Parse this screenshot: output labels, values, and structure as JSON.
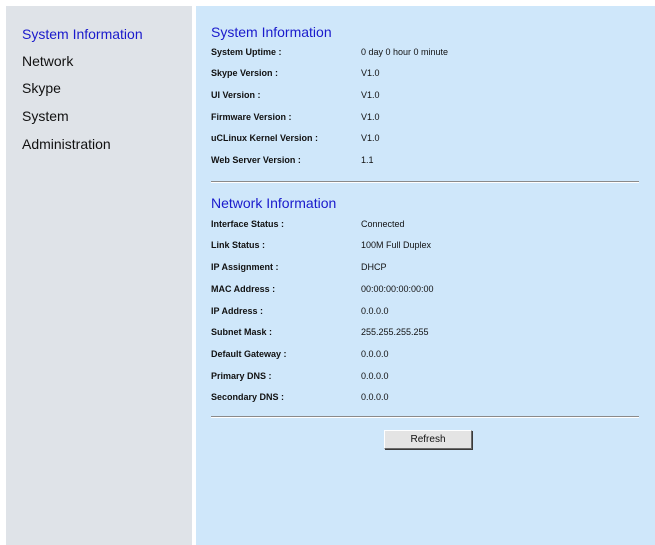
{
  "sidebar": {
    "items": [
      {
        "label": "System Information",
        "active": true
      },
      {
        "label": "Network",
        "active": false
      },
      {
        "label": "Skype",
        "active": false
      },
      {
        "label": "System",
        "active": false
      },
      {
        "label": "Administration",
        "active": false
      }
    ]
  },
  "system_info": {
    "title": "System Information",
    "rows": [
      {
        "label": "System Uptime :",
        "value": "0 day 0 hour 0 minute"
      },
      {
        "label": "Skype Version :",
        "value": "V1.0"
      },
      {
        "label": "UI Version :",
        "value": "V1.0"
      },
      {
        "label": "Firmware Version :",
        "value": "V1.0"
      },
      {
        "label": "uCLinux Kernel Version :",
        "value": "V1.0"
      },
      {
        "label": "Web Server Version :",
        "value": "1.1"
      }
    ]
  },
  "network_info": {
    "title": "Network Information",
    "rows": [
      {
        "label": "Interface Status :",
        "value": "Connected"
      },
      {
        "label": "Link Status :",
        "value": "100M Full Duplex"
      },
      {
        "label": "IP Assignment :",
        "value": "DHCP"
      },
      {
        "label": "MAC Address :",
        "value": "00:00:00:00:00:00"
      },
      {
        "label": "IP Address :",
        "value": "0.0.0.0"
      },
      {
        "label": "Subnet Mask :",
        "value": "255.255.255.255"
      },
      {
        "label": "Default Gateway :",
        "value": "0.0.0.0"
      },
      {
        "label": "Primary DNS :",
        "value": "0.0.0.0"
      },
      {
        "label": "Secondary DNS :",
        "value": "0.0.0.0"
      }
    ]
  },
  "actions": {
    "refresh_label": "Refresh"
  },
  "colors": {
    "sidebar_bg": "#dfe3e8",
    "main_bg": "#cfe7fa",
    "accent": "#1a1acc"
  }
}
